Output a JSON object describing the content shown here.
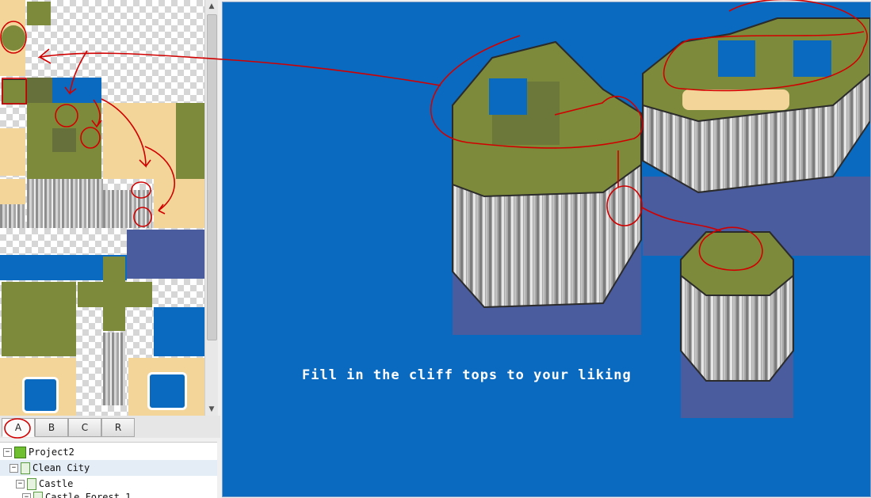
{
  "palette": {
    "water": "#0a6ac0",
    "grass": "#7d8a3b",
    "sand": "#f3d59a",
    "shadow": "#4a5b9e",
    "annotation": "#d10000"
  },
  "tileset_tabs": [
    {
      "label": "A",
      "active": true
    },
    {
      "label": "B"
    },
    {
      "label": "C"
    },
    {
      "label": "R"
    }
  ],
  "map_tree": {
    "project": "Project2",
    "nodes": [
      {
        "label": "Clean City",
        "level": 1
      },
      {
        "label": "Castle",
        "level": 2
      },
      {
        "label": "Castle Forest 1",
        "level": 3
      }
    ]
  },
  "map": {
    "caption": "Fill in the cliff tops to your liking"
  }
}
